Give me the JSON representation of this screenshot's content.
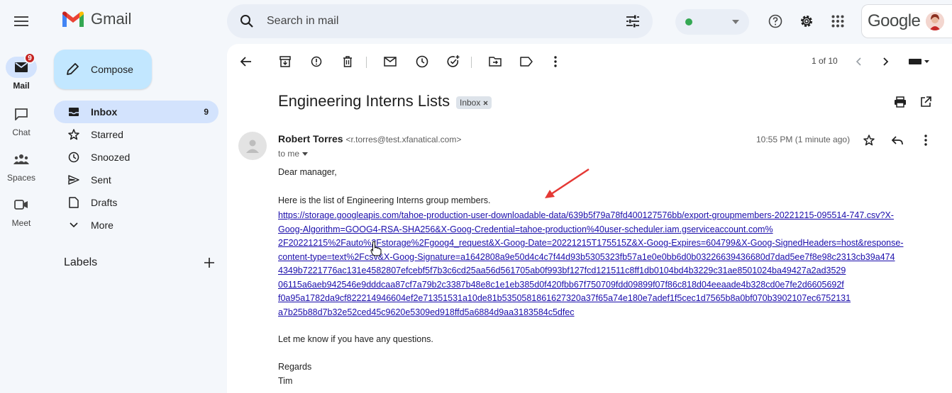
{
  "rail": {
    "mail": {
      "label": "Mail",
      "badge": "9"
    },
    "chat": {
      "label": "Chat"
    },
    "spaces": {
      "label": "Spaces"
    },
    "meet": {
      "label": "Meet"
    }
  },
  "app": {
    "name": "Gmail"
  },
  "compose": {
    "label": "Compose"
  },
  "nav": {
    "items": [
      {
        "label": "Inbox",
        "count": "9",
        "icon": "inbox-icon"
      },
      {
        "label": "Starred",
        "count": "",
        "icon": "star-icon"
      },
      {
        "label": "Snoozed",
        "count": "",
        "icon": "clock-icon"
      },
      {
        "label": "Sent",
        "count": "",
        "icon": "send-icon"
      },
      {
        "label": "Drafts",
        "count": "",
        "icon": "draft-icon"
      },
      {
        "label": "More",
        "count": "",
        "icon": "chevron-down-icon"
      }
    ],
    "labels_heading": "Labels"
  },
  "search": {
    "placeholder": "Search in mail"
  },
  "account": {
    "brand": "Google"
  },
  "toolbar": {
    "pager": "1 of 10"
  },
  "email": {
    "subject": "Engineering Interns Lists",
    "chip": "Inbox",
    "sender_name": "Robert Torres",
    "sender_email": "<r.torres@test.xfanatical.com>",
    "to": "to me",
    "time": "10:55 PM (1 minute ago)",
    "greeting": "Dear manager,",
    "intro": "Here is the list of Engineering Interns group members.",
    "link_lines": [
      "https://storage.googleapis.com/tahoe-production-user-downloadable-data/639b5f79a78fd400127576bb/export-groupmembers-20221215-095514-747.csv?X-",
      "Goog-Algorithm=GOOG4-RSA-SHA256&X-Goog-Credential=tahoe-production%40user-scheduler.iam.gserviceaccount.com%",
      "2F20221215%2Fauto%2Fstorage%2Fgoog4_request&X-Goog-Date=20221215T175515Z&X-Goog-Expires=604799&X-Goog-SignedHeaders=host&response-",
      "content-type=text%2Fcsv&X-Goog-Signature=a1642808a9e50d4c4c7f44d93b5305323fb57a1e0e0bb6d0b03226639436680d7dad5ee7f8e98c2313cb39a474",
      "4349b7221776ac131e4582807efcebf5f7b3c6cd25aa56d561705ab0f993bf127fcd121511c8ff1db0104bd4b3229c31ae8501024ba49427a2ad3529",
      "06115a6aeb942546e9dddcaa87cf7a79b2c3387b48e8c1e1eb385d0f420fbb67f750709fdd09899f07f86c818d04eeaade4b328cd0e7fe2d6605692f",
      "f0a95a1782da9cf822214946604ef2e71351531a10de81b5350581861627320a37f65a74e180e7adef1f5cec1d7565b8a0bf070b3902107ec6752131",
      "a7b25b88d7b32e52ced45c9620e5309ed918ffd5a6884d9aa3183584c5dfec"
    ],
    "closing": "Let me know if you have any questions.",
    "regards": "Regards",
    "signature": "Tim"
  },
  "colors": {
    "accent": "#d3e3fd",
    "compose": "#c2e7ff",
    "link": "#1a0dab",
    "arrow": "#e53935"
  }
}
